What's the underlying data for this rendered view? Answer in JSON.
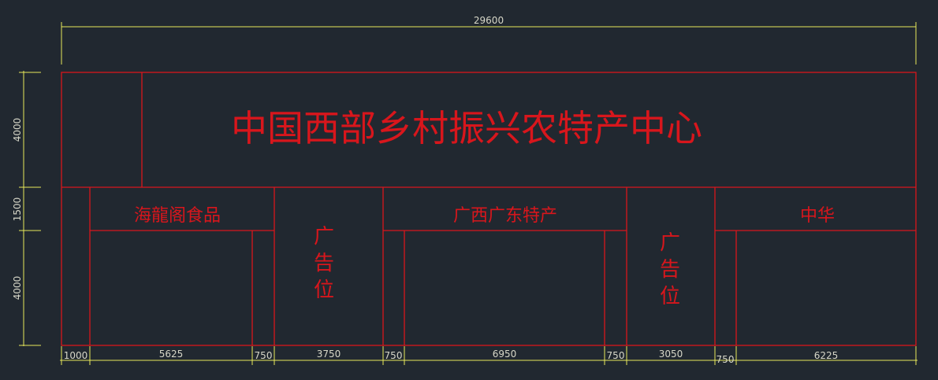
{
  "title": "中国西部乡村振兴农特产中心",
  "shops": {
    "left": "海龍阁食品",
    "middle": "广西广东特产",
    "right": "中华"
  },
  "ad_label": [
    "广",
    "告",
    "位"
  ],
  "dimensions": {
    "total_width": "29600",
    "heights": [
      "4000",
      "1500",
      "4000"
    ],
    "bottom": [
      "1000",
      "5625",
      "750",
      "3750",
      "750",
      "6950",
      "750",
      "3050",
      "750",
      "6225"
    ]
  }
}
